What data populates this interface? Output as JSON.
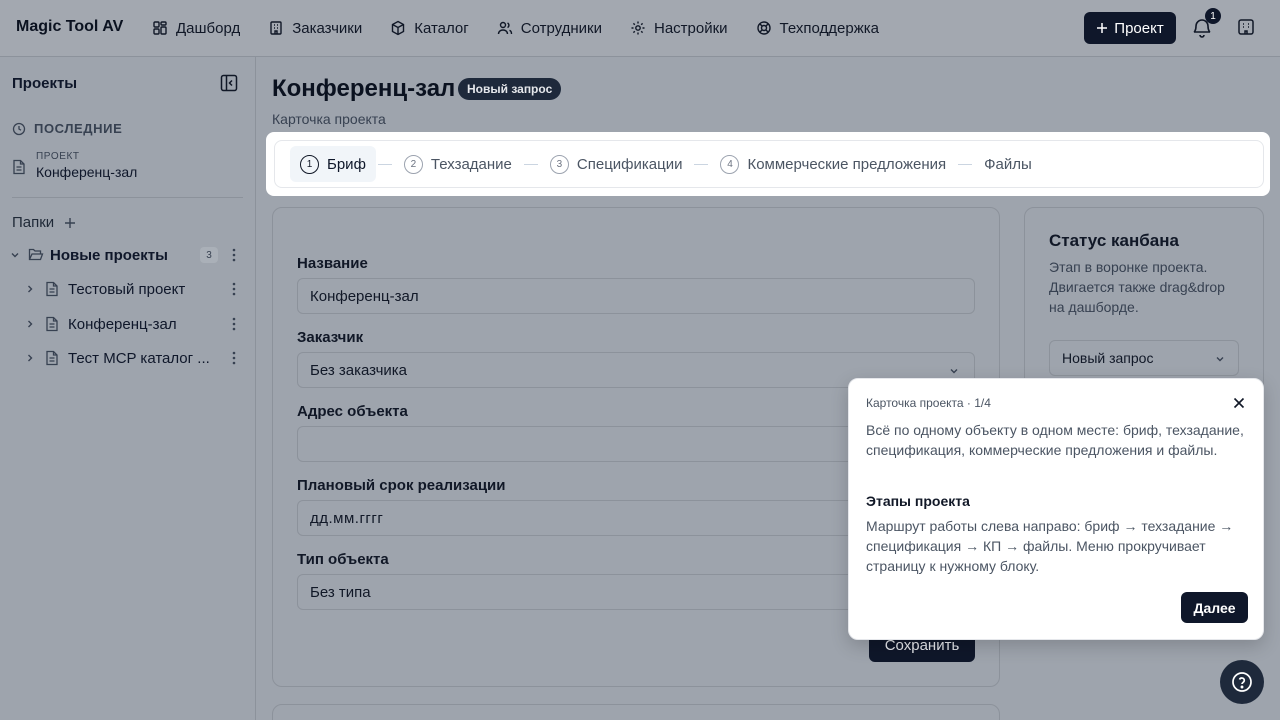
{
  "app": {
    "name": "Magic Tool AV"
  },
  "nav": [
    {
      "label": "Дашборд",
      "icon": "dashboard-icon"
    },
    {
      "label": "Заказчики",
      "icon": "building-icon"
    },
    {
      "label": "Каталог",
      "icon": "box-icon"
    },
    {
      "label": "Сотрудники",
      "icon": "users-icon"
    },
    {
      "label": "Настройки",
      "icon": "gear-icon"
    },
    {
      "label": "Техподдержка",
      "icon": "lifebuoy-icon"
    }
  ],
  "header": {
    "new_project_label": "Проект",
    "notifications_count": "1"
  },
  "sidebar": {
    "title": "Проекты",
    "recent_label": "ПОСЛЕДНИЕ",
    "recent_item": {
      "kind": "ПРОЕКТ",
      "name": "Конференц-зал"
    },
    "folders_label": "Папки",
    "folder": {
      "name": "Новые проекты",
      "count": "3"
    },
    "projects": [
      "Тестовый проект",
      "Конференц-зал",
      "Тест MCP каталог ..."
    ]
  },
  "page": {
    "title": "Конференц-зал",
    "status": "Новый запрос",
    "subtitle": "Карточка проекта"
  },
  "steps": [
    {
      "num": "1",
      "label": "Бриф",
      "active": true
    },
    {
      "num": "2",
      "label": "Техзадание"
    },
    {
      "num": "3",
      "label": "Спецификации"
    },
    {
      "num": "4",
      "label": "Коммерческие предложения"
    },
    {
      "label": "Файлы"
    }
  ],
  "form": {
    "name_label": "Название",
    "name_value": "Конференц-зал",
    "customer_label": "Заказчик",
    "customer_value": "Без заказчика",
    "address_label": "Адрес объекта",
    "address_value": "",
    "deadline_label": "Плановый срок реализации",
    "deadline_value": "дд.мм.гггг",
    "type_label": "Тип объекта",
    "type_value": "Без типа",
    "save_label": "Сохранить"
  },
  "kanban": {
    "title": "Статус канбана",
    "description": "Этап в воронке проекта. Двигается также drag&drop на дашборде.",
    "value": "Новый запрос"
  },
  "tour": {
    "step": "Карточка проекта · 1/4",
    "text": "Всё по одному объекту в одном месте: бриф, техзадание, спецификация, коммерческие предложения и файлы.",
    "heading": "Этапы проекта",
    "text2": "Маршрут работы слева направо: бриф → техзадание → спецификация → КП → файлы. Меню прокручивает страницу к нужному блоку.",
    "next_label": "Далее"
  }
}
